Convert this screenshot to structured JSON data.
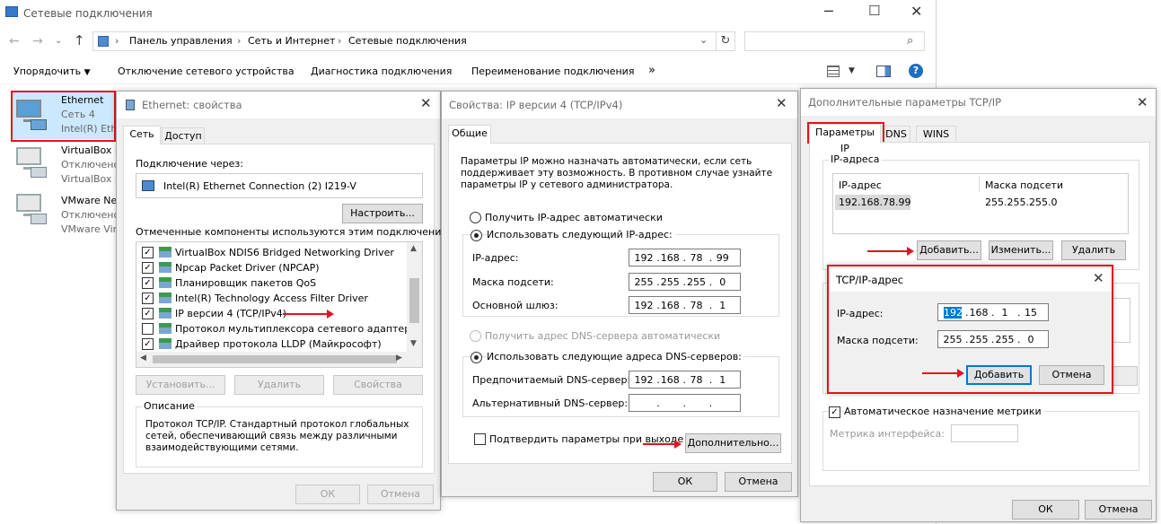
{
  "explorer": {
    "window_title": "Сетевые подключения",
    "breadcrumbs": [
      "Панель управления",
      "Сеть и Интернет",
      "Сетевые подключения"
    ],
    "search_placeholder": "",
    "toolbar": {
      "organize": "Упорядочить",
      "disable": "Отключение сетевого устройства",
      "diagnose": "Диагностика подключения",
      "rename": "Переименование подключения",
      "more": "»"
    },
    "connections": [
      {
        "name": "Ethernet",
        "status": "Сеть  4",
        "device": "Intel(R) Eth"
      },
      {
        "name": "VirtualBox H",
        "status": "Отключено",
        "device": "VirtualBox H"
      },
      {
        "name": "VMware Ne",
        "status": "Отключено",
        "device": "VMware Vir"
      }
    ]
  },
  "eth_props": {
    "title": "Ethernet: свойства",
    "tabs": [
      "Сеть",
      "Доступ"
    ],
    "connect_using_label": "Подключение через:",
    "adapter": "Intel(R) Ethernet Connection (2) I219-V",
    "configure": "Настроить...",
    "components_label": "Отмеченные компоненты используются этим подключением:",
    "components": [
      {
        "label": "VirtualBox NDIS6 Bridged Networking Driver",
        "check": "✓"
      },
      {
        "label": "Npcap Packet Driver (NPCAP)",
        "check": "✓"
      },
      {
        "label": "Планировщик пакетов QoS",
        "check": "✓"
      },
      {
        "label": "Intel(R) Technology Access Filter Driver",
        "check": "✓"
      },
      {
        "label": "IP версии 4 (TCP/IPv4)",
        "check": "✓"
      },
      {
        "label": "Протокол мультиплексора сетевого адаптера (Май",
        "check": ""
      },
      {
        "label": "Драйвер протокола LLDP (Майкрософт)",
        "check": "✓"
      }
    ],
    "install": "Установить...",
    "remove": "Удалить",
    "properties": "Свойства",
    "description_title": "Описание",
    "description": "Протокол TCP/IP. Стандартный протокол глобальных\nсетей, обеспечивающий связь между различными\nвзаимодействующими сетями.",
    "ok": "ОК",
    "cancel": "Отмена"
  },
  "ipv4": {
    "title": "Свойства: IP версии 4 (TCP/IPv4)",
    "tab": "Общие",
    "intro": "Параметры IP можно назначать автоматически, если сеть\nподдерживает эту возможность. В противном случае узнайте\nпараметры IP у сетевого администратора.",
    "auto_ip": "Получить IP-адрес автоматически",
    "manual_ip": "Использовать следующий IP-адрес:",
    "ip_label": "IP-адрес:",
    "ip": [
      "192",
      "168",
      "78",
      "99"
    ],
    "mask_label": "Маска подсети:",
    "mask": [
      "255",
      "255",
      "255",
      "0"
    ],
    "gw_label": "Основной шлюз:",
    "gw": [
      "192",
      "168",
      "78",
      "1"
    ],
    "auto_dns": "Получить адрес DNS-сервера автоматически",
    "manual_dns": "Использовать следующие адреса DNS-серверов:",
    "dns1_label": "Предпочитаемый DNS-сервер:",
    "dns1": [
      "192",
      "168",
      "78",
      "1"
    ],
    "dns2_label": "Альтернативный DNS-сервер:",
    "dns2": [
      "",
      "",
      "",
      ""
    ],
    "validate": "Подтвердить параметры при выходе",
    "advanced": "Дополнительно...",
    "ok": "ОК",
    "cancel": "Отмена"
  },
  "advanced": {
    "title": "Дополнительные параметры TCP/IP",
    "tabs": [
      "Параметры IP",
      "DNS",
      "WINS"
    ],
    "ip_group": "IP-адреса",
    "col_ip": "IP-адрес",
    "col_mask": "Маска подсети",
    "row_ip": "192.168.78.99",
    "row_mask": "255.255.255.0",
    "add": "Добавить...",
    "edit": "Изменить...",
    "remove": "Удалить",
    "auto_metric": "Автоматическое назначение метрики",
    "metric_label": "Метрика интерфейса:",
    "ok": "ОК",
    "cancel": "Отмена"
  },
  "addip": {
    "title": "TCP/IP-адрес",
    "ip_label": "IP-адрес:",
    "ip": [
      "192",
      "168",
      "1",
      "15"
    ],
    "mask_label": "Маска подсети:",
    "mask": [
      "255",
      "255",
      "255",
      "0"
    ],
    "add": "Добавить",
    "cancel": "Отмена"
  },
  "colors": {
    "accent": "#0078d7",
    "highlight": "#e0141e",
    "select": "#cce8ff"
  }
}
